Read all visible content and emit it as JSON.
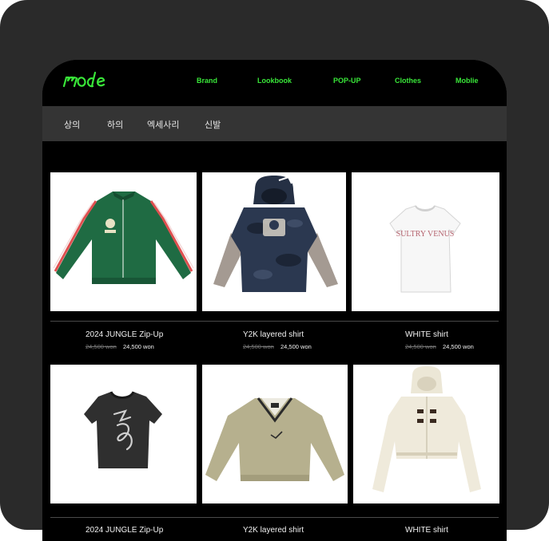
{
  "brand": {
    "logo_text": "mode",
    "accent_color": "#39e639"
  },
  "nav": {
    "items": [
      {
        "label": "Brand"
      },
      {
        "label": "Lookbook"
      },
      {
        "label": "POP-UP"
      },
      {
        "label": "Clothes"
      },
      {
        "label": "Moblie"
      }
    ]
  },
  "categories": [
    {
      "label": "상의"
    },
    {
      "label": "하의"
    },
    {
      "label": "엑세사리"
    },
    {
      "label": "신발"
    }
  ],
  "products": [
    {
      "name": "2024 JUNGLE Zip-Up",
      "old_price": "24,500 won",
      "price": "24,500 won",
      "image": "green-track-jacket"
    },
    {
      "name": "Y2K layered shirt",
      "old_price": "24,500 won",
      "price": "24,500 won",
      "image": "camo-hoodie-layered"
    },
    {
      "name": "WHITE shirt",
      "old_price": "24,500 won",
      "price": "24,500 won",
      "image": "white-tee-sultry-venus"
    },
    {
      "name": "2024 JUNGLE Zip-Up",
      "image": "black-graphic-tee"
    },
    {
      "name": "Y2K layered shirt",
      "image": "beige-pullover"
    },
    {
      "name": "WHITE shirt",
      "image": "cream-knit-hoodie"
    }
  ],
  "image_text": {
    "tee_print": "SULTRY VENUS"
  }
}
